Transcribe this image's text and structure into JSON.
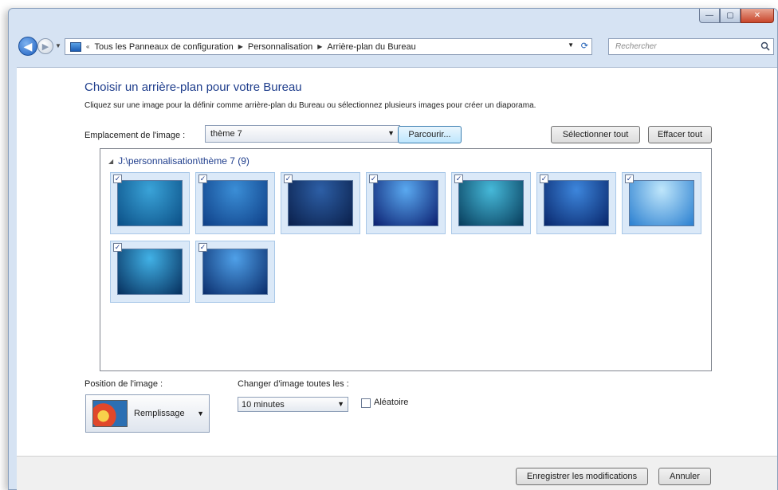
{
  "window": {
    "caption_buttons": {
      "minimize": "—",
      "maximize": "▢",
      "close": "✕"
    }
  },
  "nav": {
    "back_icon": "back-arrow-icon",
    "forward_icon": "forward-arrow-icon",
    "breadcrumbs": [
      "Tous les Panneaux de configuration",
      "Personnalisation",
      "Arrière-plan du Bureau"
    ],
    "search_placeholder": "Rechercher"
  },
  "main": {
    "title": "Choisir un arrière-plan pour votre Bureau",
    "subtitle": "Cliquez sur une image pour la définir comme arrière-plan du Bureau ou sélectionnez plusieurs images pour créer un diaporama.",
    "location_label": "Emplacement de l'image :",
    "location_value": "thème 7",
    "browse_label": "Parcourir...",
    "select_all_label": "Sélectionner tout",
    "clear_all_label": "Effacer tout",
    "folder_header": "J:\\personnalisation\\thème 7 (9)",
    "thumbnails": [
      {
        "checked": true,
        "colors": [
          "#3aa3d8",
          "#0b4f86"
        ]
      },
      {
        "checked": true,
        "colors": [
          "#3b8ed6",
          "#0e3f87"
        ]
      },
      {
        "checked": true,
        "colors": [
          "#2d5fa6",
          "#0a1f4a"
        ]
      },
      {
        "checked": true,
        "colors": [
          "#5aa9f0",
          "#0b1f70"
        ]
      },
      {
        "checked": true,
        "colors": [
          "#46b9d9",
          "#073c5b"
        ]
      },
      {
        "checked": true,
        "colors": [
          "#3d86dc",
          "#08266b"
        ]
      },
      {
        "checked": true,
        "colors": [
          "#bfe6fb",
          "#2a7fd0"
        ]
      },
      {
        "checked": true,
        "colors": [
          "#41b1e6",
          "#062f5d"
        ]
      },
      {
        "checked": true,
        "colors": [
          "#4fa0e8",
          "#0a2d6c"
        ]
      }
    ],
    "position_label": "Position de l'image :",
    "position_value": "Remplissage",
    "change_label": "Changer d'image toutes les :",
    "change_value": "10 minutes",
    "random_label": "Aléatoire",
    "random_checked": false
  },
  "footer": {
    "save_label": "Enregistrer les modifications",
    "cancel_label": "Annuler"
  }
}
